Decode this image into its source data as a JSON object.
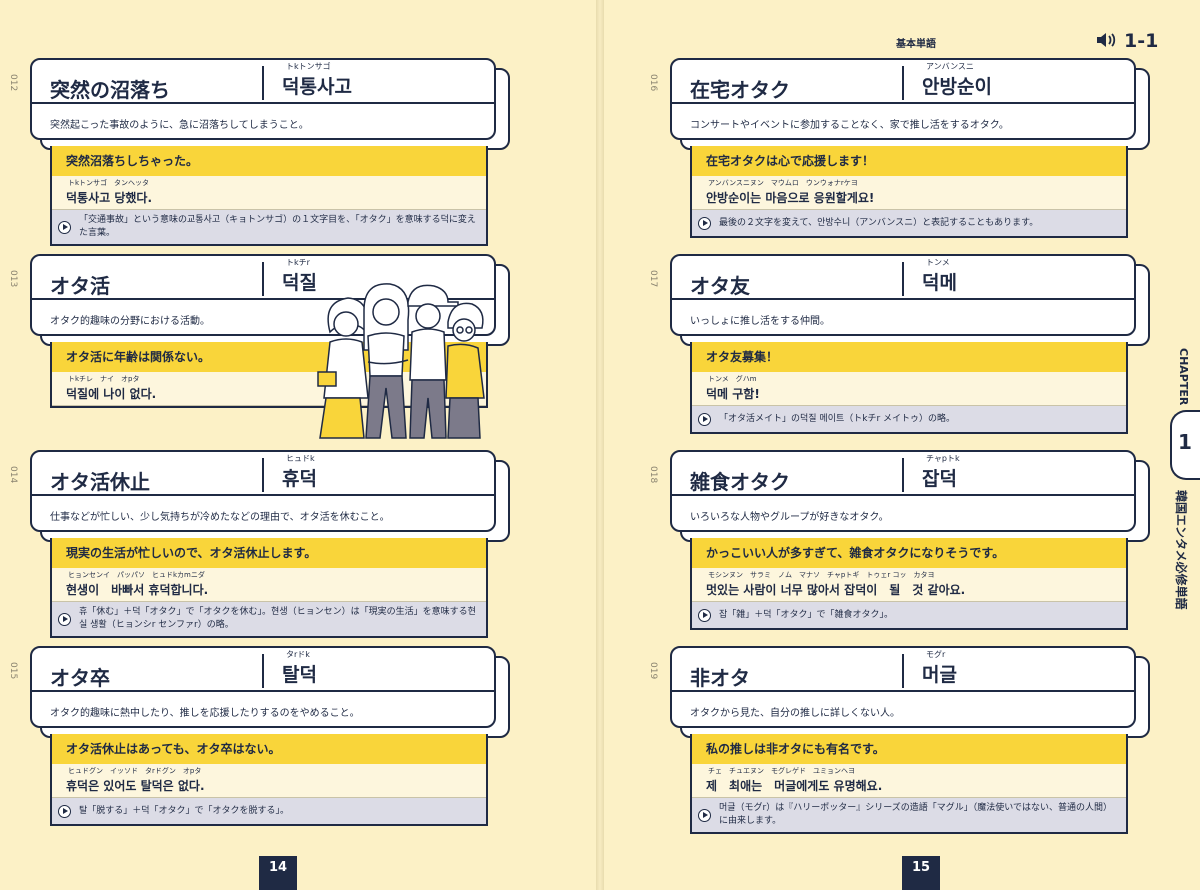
{
  "header": {
    "label": "基本単語",
    "track": "1-1",
    "speaker_icon": "speaker-icon"
  },
  "chapter": {
    "label": "CHAPTER",
    "number": "1",
    "title": "韓国エンタメ必修単語"
  },
  "pages": {
    "left": "14",
    "right": "15"
  },
  "entries": [
    {
      "num": "012",
      "term": "突然の沼落ち",
      "ruby": "トkトンサゴ",
      "korean": "덕통사고",
      "desc": "突然起こった事故のように、急に沼落ちしてしまうこと。",
      "ex_jp": "突然沼落ちしちゃった。",
      "ex_ruby": "トkトンサゴ　タンヘッタ",
      "ex_ko": "덕통사고 당했다.",
      "note": "「交通事故」という意味の교통사고（キョトンサゴ）の１文字目を、「オタク」を意味する덕に変えた言葉。"
    },
    {
      "num": "013",
      "term": "オタ活",
      "ruby": "トkチr",
      "korean": "덕질",
      "desc": "オタク的趣味の分野における活動。",
      "ex_jp": "オタ活に年齢は関係ない。",
      "ex_ruby": "トkチレ　ナイ　オpタ",
      "ex_ko": "덕질에 나이 없다.",
      "note": ""
    },
    {
      "num": "014",
      "term": "オタ活休止",
      "ruby": "ヒュドk",
      "korean": "휴덕",
      "desc": "仕事などが忙しい、少し気持ちが冷めたなどの理由で、オタ活を休むこと。",
      "ex_jp": "現実の生活が忙しいので、オタ活休止します。",
      "ex_ruby": "ヒョンセンイ　パッパソ　ヒュドkカmニダ",
      "ex_ko": "현생이　바빠서 휴덕합니다.",
      "note": "휴「休む」＋덕「オタク」で「オタクを休む」。현생（ヒョンセン）は「現実の生活」を意味する현실 생활（ヒョンシr センファr）の略。"
    },
    {
      "num": "015",
      "term": "オタ卒",
      "ruby": "タrドk",
      "korean": "탈덕",
      "desc": "オタク的趣味に熱中したり、推しを応援したりするのをやめること。",
      "ex_jp": "オタ活休止はあっても、オタ卒はない。",
      "ex_ruby": "ヒュドグン　イッソド　タrドグン　オpタ",
      "ex_ko": "휴덕은 있어도 탈덕은 없다.",
      "note": "탈「脱する」＋덕「オタク」で「オタクを脱する」。"
    },
    {
      "num": "016",
      "term": "在宅オタク",
      "ruby": "アンバンスニ",
      "korean": "안방순이",
      "desc": "コンサートやイベントに参加することなく、家で推し活をするオタク。",
      "ex_jp": "在宅オタクは心で応援します！",
      "ex_ruby": "アンバンスニヌン　マウムロ　ウンウォナrケヨ",
      "ex_ko": "안방순이는 마음으로 응원할게요!",
      "note": "最後の２文字を変えて、안방수니（アンバンスニ）と表記することもあります。"
    },
    {
      "num": "017",
      "term": "オタ友",
      "ruby": "トンメ",
      "korean": "덕메",
      "desc": "いっしょに推し活をする仲間。",
      "ex_jp": "オタ友募集！",
      "ex_ruby": "トンメ　グハm",
      "ex_ko": "덕메 구함!",
      "note": "「オタ活メイト」の덕질 메이트（トkチr メイトゥ）の略。"
    },
    {
      "num": "018",
      "term": "雑食オタク",
      "ruby": "チャpトk",
      "korean": "잡덕",
      "desc": "いろいろな人物やグループが好きなオタク。",
      "ex_jp": "かっこいい人が多すぎて、雑食オタクになりそうです。",
      "ex_ruby": "モシンヌン　サラミ　ノム　マナソ　チャpトギ　トゥェr コッ　カタヨ",
      "ex_ko": "멋있는 사람이 너무 많아서 잡덕이　될　것 같아요.",
      "note": "잡「雑」＋덕「オタク」で「雑食オタク」。"
    },
    {
      "num": "019",
      "term": "非オタ",
      "ruby": "モグr",
      "korean": "머글",
      "desc": "オタクから見た、自分の推しに詳しくない人。",
      "ex_jp": "私の推しは非オタにも有名です。",
      "ex_ruby": "チェ　チュエヌン　モグレゲド　ユミョンヘヨ",
      "ex_ko": "제　최애는　머글에게도 유명해요.",
      "note": "머글（モグr）は『ハリーポッター』シリーズの造語「マグル」（魔法使いではない、普通の人間）に由来します。"
    }
  ]
}
